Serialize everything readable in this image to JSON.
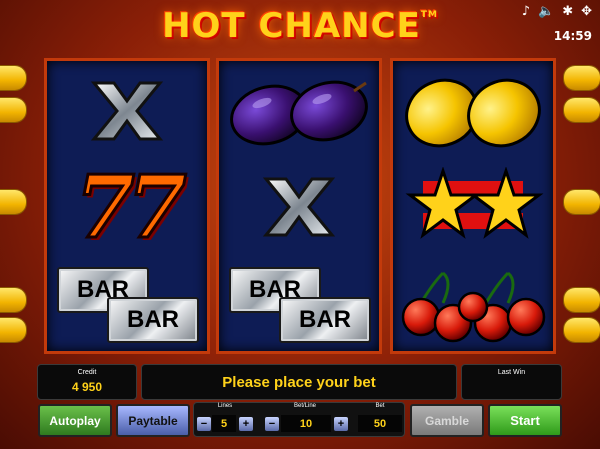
{
  "header": {
    "title": "HOT CHANCE",
    "trademark": "TM",
    "clock": "14:59",
    "icons": [
      "music-note-icon",
      "speaker-icon",
      "settings-icon",
      "fullscreen-icon"
    ]
  },
  "reels": {
    "reel1": [
      "X",
      "7",
      "BAR"
    ],
    "reel2": [
      "plum",
      "X",
      "BAR"
    ],
    "reel3": [
      "lemon",
      "star",
      "cherry"
    ]
  },
  "symbols": {
    "x": "X",
    "seven": "77",
    "bar": "BAR"
  },
  "info": {
    "credit_label": "Credit",
    "credit_value": "4 950",
    "message": "Please place your bet",
    "last_win_label": "Last Win",
    "last_win_value": ""
  },
  "controls": {
    "autoplay": "Autoplay",
    "paytable": "Paytable",
    "lines_label": "Lines",
    "lines_value": "5",
    "betline_label": "Bet/Line",
    "betline_value": "10",
    "bet_label": "Bet",
    "bet_value": "50",
    "gamble": "Gamble",
    "start": "Start",
    "minus": "−",
    "plus": "+"
  },
  "colors": {
    "reel_bg": "#0e1c55",
    "reel_border": "#c33a0b",
    "gold": "#ffd21a",
    "start": "#2fae2a",
    "autoplay": "#3f8a2f",
    "paytable": "#3b4f9e"
  }
}
